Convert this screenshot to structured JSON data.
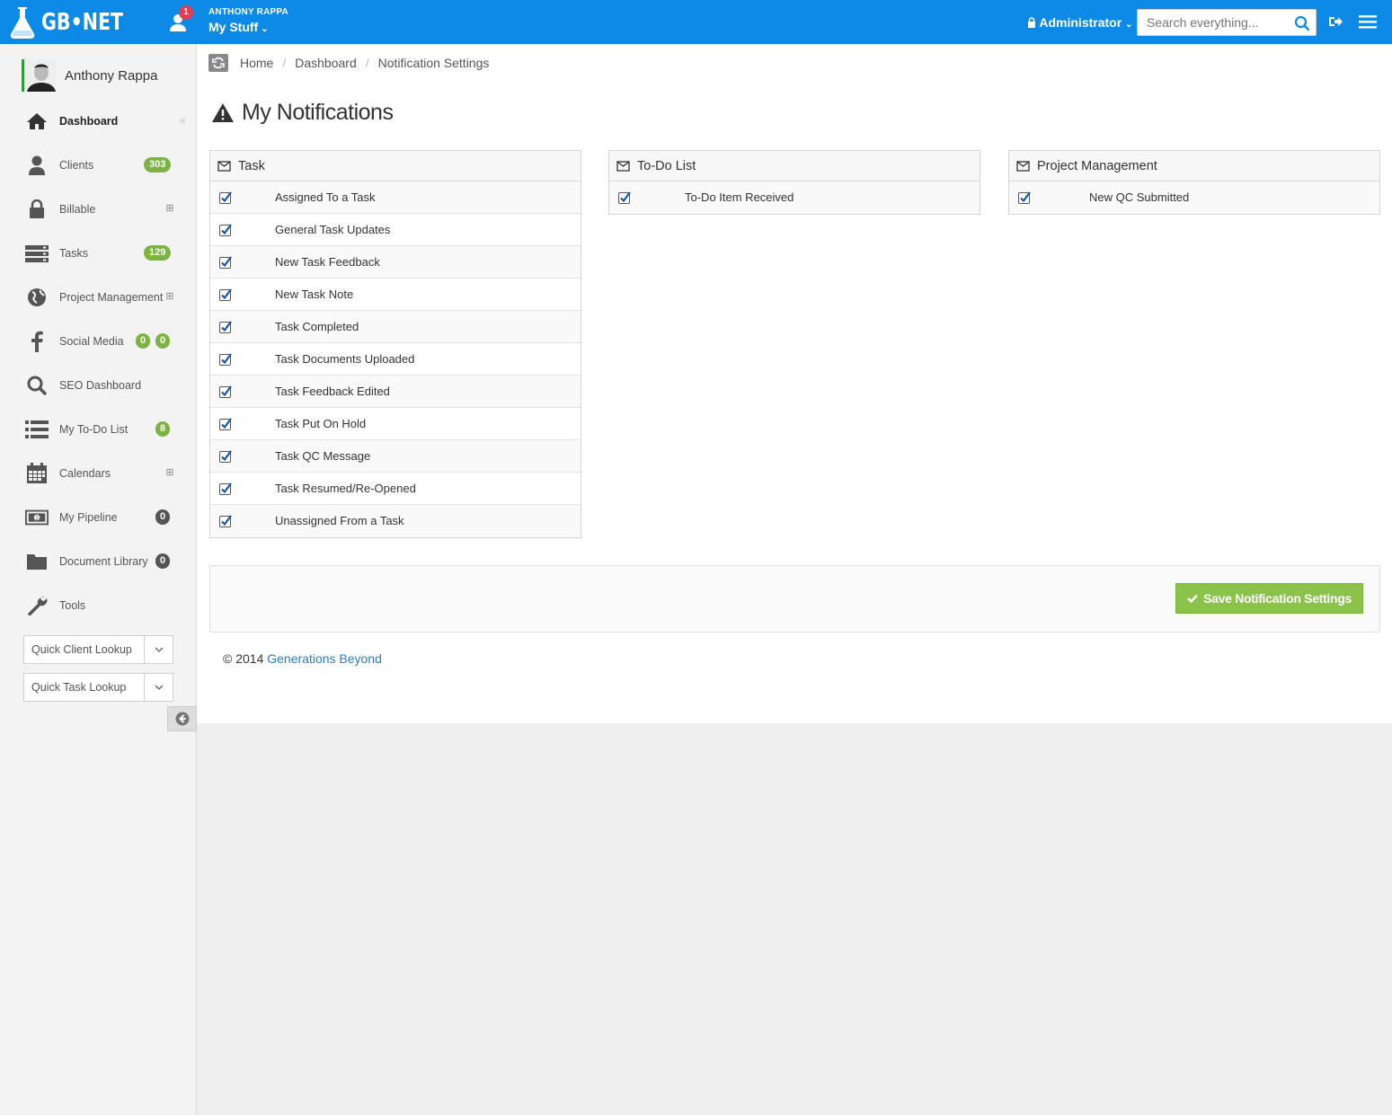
{
  "topbar": {
    "logo": "GB•NET",
    "notification_count": "1",
    "user_caps": "ANTHONY RAPPA",
    "my_stuff": "My Stuff",
    "admin_label": "Administrator",
    "search_placeholder": "Search everything...",
    "color": "#0d8ae6"
  },
  "sidebar": {
    "profile_name": "Anthony Rappa",
    "items": [
      {
        "label": "Dashboard",
        "icon": "home-icon",
        "active": true
      },
      {
        "label": "Clients",
        "icon": "user-icon",
        "badge": "303"
      },
      {
        "label": "Billable",
        "icon": "lock-icon",
        "expand": "⊞"
      },
      {
        "label": "Tasks",
        "icon": "tasks-icon",
        "badge": "129"
      },
      {
        "label": "Project Management",
        "icon": "globe-icon",
        "expand": "⊞"
      },
      {
        "label": "Social Media",
        "icon": "facebook-icon",
        "badges": [
          "0",
          "0"
        ]
      },
      {
        "label": "SEO Dashboard",
        "icon": "search-icon"
      },
      {
        "label": "My To-Do List",
        "icon": "list-icon",
        "badge": "8"
      },
      {
        "label": "Calendars",
        "icon": "calendar-icon",
        "expand": "⊞"
      },
      {
        "label": "My Pipeline",
        "icon": "money-icon",
        "badge": "0"
      },
      {
        "label": "Document Library",
        "icon": "folder-icon",
        "badge": "0"
      },
      {
        "label": "Tools",
        "icon": "wrench-icon"
      }
    ],
    "quick_client": "Quick Client Lookup",
    "quick_task": "Quick Task Lookup"
  },
  "breadcrumb": [
    "Home",
    "Dashboard",
    "Notification Settings"
  ],
  "page_title": "My Notifications",
  "panels": [
    {
      "title": "Task",
      "items": [
        "Assigned To a Task",
        "General Task Updates",
        "New Task Feedback",
        "New Task Note",
        "Task Completed",
        "Task Documents Uploaded",
        "Task Feedback Edited",
        "Task Put On Hold",
        "Task QC Message",
        "Task Resumed/Re-Opened",
        "Unassigned From a Task"
      ]
    },
    {
      "title": "To-Do List",
      "items": [
        "To-Do Item Received"
      ]
    },
    {
      "title": "Project Management",
      "items": [
        "New QC Submitted"
      ]
    }
  ],
  "save_button": "Save Notification Settings",
  "footer": {
    "copyright": "© 2014",
    "company": "Generations Beyond"
  }
}
